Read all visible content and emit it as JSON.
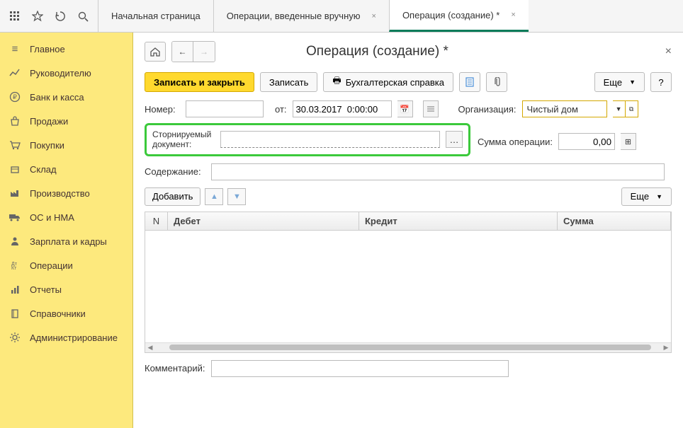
{
  "tabs": {
    "home": "Начальная страница",
    "manual": "Операции, введенные вручную",
    "create": "Операция (создание) *"
  },
  "sidebar": {
    "items": [
      {
        "label": "Главное",
        "icon": "menu"
      },
      {
        "label": "Руководителю",
        "icon": "chart"
      },
      {
        "label": "Банк и касса",
        "icon": "ruble"
      },
      {
        "label": "Продажи",
        "icon": "bag"
      },
      {
        "label": "Покупки",
        "icon": "cart"
      },
      {
        "label": "Склад",
        "icon": "box"
      },
      {
        "label": "Производство",
        "icon": "factory"
      },
      {
        "label": "ОС и НМА",
        "icon": "truck"
      },
      {
        "label": "Зарплата и кадры",
        "icon": "person"
      },
      {
        "label": "Операции",
        "icon": "ops"
      },
      {
        "label": "Отчеты",
        "icon": "report"
      },
      {
        "label": "Справочники",
        "icon": "book"
      },
      {
        "label": "Администрирование",
        "icon": "gear"
      }
    ]
  },
  "page": {
    "title": "Операция (создание) *",
    "toolbar": {
      "save_close": "Записать и закрыть",
      "save": "Записать",
      "print_ref": "Бухгалтерская справка",
      "more": "Еще",
      "help": "?"
    },
    "fields": {
      "number_label": "Номер:",
      "number_value": "",
      "from_label": "от:",
      "date_value": "30.03.2017  0:00:00",
      "org_label": "Организация:",
      "org_value": "Чистый дом",
      "storno_label": "Сторнируемый документ:",
      "storno_value": "",
      "sum_label": "Сумма операции:",
      "sum_value": "0,00",
      "content_label": "Содержание:",
      "content_value": "",
      "comment_label": "Комментарий:",
      "comment_value": ""
    },
    "grid_toolbar": {
      "add": "Добавить",
      "more": "Еще"
    },
    "grid": {
      "cols": {
        "n": "N",
        "debit": "Дебет",
        "credit": "Кредит",
        "sum": "Сумма"
      }
    }
  }
}
